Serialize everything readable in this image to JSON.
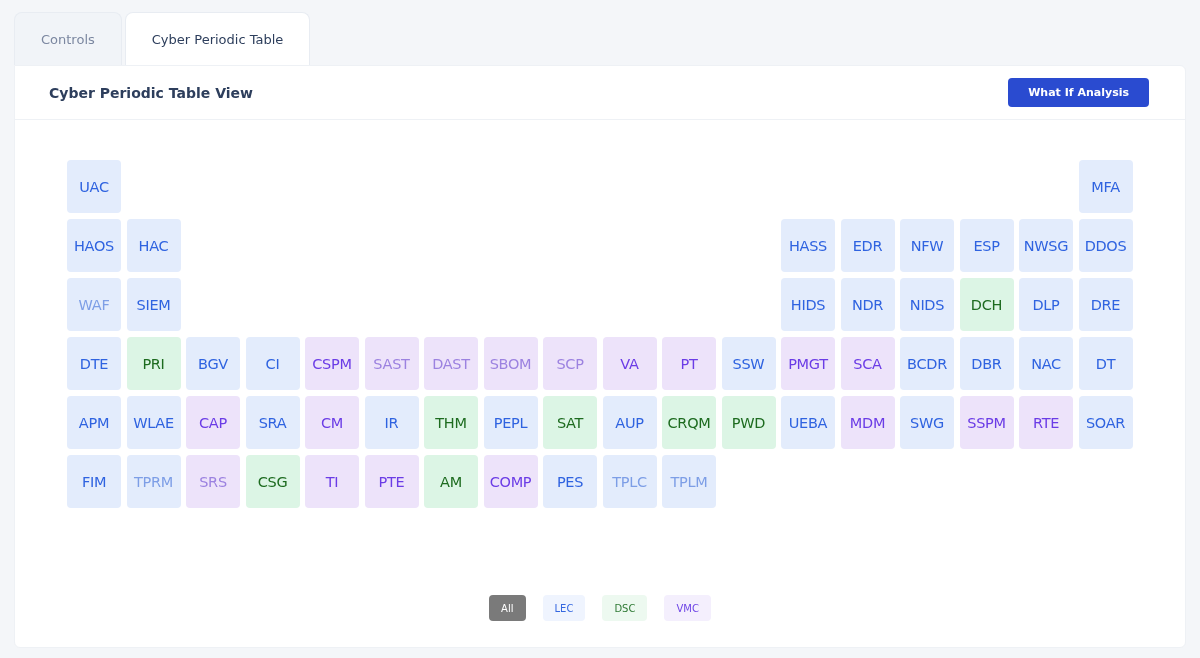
{
  "tabs": [
    {
      "label": "Controls",
      "selected": false
    },
    {
      "label": "Cyber Periodic Table",
      "selected": true
    }
  ],
  "panel": {
    "title": "Cyber Periodic Table View",
    "button": "What If Analysis"
  },
  "rows": [
    {
      "left": [
        {
          "code": "UAC",
          "kind": "lec",
          "dimmed": false
        }
      ],
      "right": [
        {
          "code": "MFA",
          "kind": "lec",
          "dimmed": false
        }
      ]
    },
    {
      "left": [
        {
          "code": "HAOS",
          "kind": "lec",
          "dimmed": false
        },
        {
          "code": "HAC",
          "kind": "lec",
          "dimmed": false
        }
      ],
      "right": [
        {
          "code": "HASS",
          "kind": "lec",
          "dimmed": false
        },
        {
          "code": "EDR",
          "kind": "lec",
          "dimmed": false
        },
        {
          "code": "NFW",
          "kind": "lec",
          "dimmed": false
        },
        {
          "code": "ESP",
          "kind": "lec",
          "dimmed": false
        },
        {
          "code": "NWSG",
          "kind": "lec",
          "dimmed": false
        },
        {
          "code": "DDOS",
          "kind": "lec",
          "dimmed": false
        }
      ]
    },
    {
      "left": [
        {
          "code": "WAF",
          "kind": "lec",
          "dimmed": true
        },
        {
          "code": "SIEM",
          "kind": "lec",
          "dimmed": false
        }
      ],
      "right": [
        {
          "code": "HIDS",
          "kind": "lec",
          "dimmed": false
        },
        {
          "code": "NDR",
          "kind": "lec",
          "dimmed": false
        },
        {
          "code": "NIDS",
          "kind": "lec",
          "dimmed": false
        },
        {
          "code": "DCH",
          "kind": "dsc",
          "dimmed": false
        },
        {
          "code": "DLP",
          "kind": "lec",
          "dimmed": false
        },
        {
          "code": "DRE",
          "kind": "lec",
          "dimmed": false
        }
      ]
    },
    {
      "left": [
        {
          "code": "DTE",
          "kind": "lec",
          "dimmed": false
        },
        {
          "code": "PRI",
          "kind": "dsc",
          "dimmed": false
        },
        {
          "code": "BGV",
          "kind": "lec",
          "dimmed": false
        },
        {
          "code": "CI",
          "kind": "lec",
          "dimmed": false
        },
        {
          "code": "CSPM",
          "kind": "vmc",
          "dimmed": false
        },
        {
          "code": "SAST",
          "kind": "vmc",
          "dimmed": true
        },
        {
          "code": "DAST",
          "kind": "vmc",
          "dimmed": true
        },
        {
          "code": "SBOM",
          "kind": "vmc",
          "dimmed": true
        },
        {
          "code": "SCP",
          "kind": "vmc",
          "dimmed": true
        },
        {
          "code": "VA",
          "kind": "vmc",
          "dimmed": false
        },
        {
          "code": "PT",
          "kind": "vmc",
          "dimmed": false
        },
        {
          "code": "SSW",
          "kind": "lec",
          "dimmed": false
        },
        {
          "code": "PMGT",
          "kind": "vmc",
          "dimmed": false
        },
        {
          "code": "SCA",
          "kind": "vmc",
          "dimmed": false
        },
        {
          "code": "BCDR",
          "kind": "lec",
          "dimmed": false
        },
        {
          "code": "DBR",
          "kind": "lec",
          "dimmed": false
        },
        {
          "code": "NAC",
          "kind": "lec",
          "dimmed": false
        },
        {
          "code": "DT",
          "kind": "lec",
          "dimmed": false
        }
      ],
      "right": []
    },
    {
      "left": [
        {
          "code": "APM",
          "kind": "lec",
          "dimmed": false
        },
        {
          "code": "WLAE",
          "kind": "lec",
          "dimmed": false
        },
        {
          "code": "CAP",
          "kind": "vmc",
          "dimmed": false
        },
        {
          "code": "SRA",
          "kind": "lec",
          "dimmed": false
        },
        {
          "code": "CM",
          "kind": "vmc",
          "dimmed": false
        },
        {
          "code": "IR",
          "kind": "lec",
          "dimmed": false
        },
        {
          "code": "THM",
          "kind": "dsc",
          "dimmed": false
        },
        {
          "code": "PEPL",
          "kind": "lec",
          "dimmed": false
        },
        {
          "code": "SAT",
          "kind": "dsc",
          "dimmed": false
        },
        {
          "code": "AUP",
          "kind": "lec",
          "dimmed": false
        },
        {
          "code": "CRQM",
          "kind": "dsc",
          "dimmed": false
        },
        {
          "code": "PWD",
          "kind": "dsc",
          "dimmed": false
        },
        {
          "code": "UEBA",
          "kind": "lec",
          "dimmed": false
        },
        {
          "code": "MDM",
          "kind": "vmc",
          "dimmed": false
        },
        {
          "code": "SWG",
          "kind": "lec",
          "dimmed": false
        },
        {
          "code": "SSPM",
          "kind": "vmc",
          "dimmed": false
        },
        {
          "code": "RTE",
          "kind": "vmc",
          "dimmed": false
        },
        {
          "code": "SOAR",
          "kind": "lec",
          "dimmed": false
        }
      ],
      "right": []
    },
    {
      "left": [
        {
          "code": "FIM",
          "kind": "lec",
          "dimmed": false
        },
        {
          "code": "TPRM",
          "kind": "lec",
          "dimmed": true
        },
        {
          "code": "SRS",
          "kind": "vmc",
          "dimmed": true
        },
        {
          "code": "CSG",
          "kind": "dsc",
          "dimmed": false
        },
        {
          "code": "TI",
          "kind": "vmc",
          "dimmed": false
        },
        {
          "code": "PTE",
          "kind": "vmc",
          "dimmed": false
        },
        {
          "code": "AM",
          "kind": "dsc",
          "dimmed": false
        },
        {
          "code": "COMP",
          "kind": "vmc",
          "dimmed": false
        },
        {
          "code": "PES",
          "kind": "lec",
          "dimmed": false
        },
        {
          "code": "TPLC",
          "kind": "lec",
          "dimmed": true
        },
        {
          "code": "TPLM",
          "kind": "lec",
          "dimmed": true
        }
      ],
      "right": []
    }
  ],
  "filters": [
    {
      "label": "All",
      "kind": "all",
      "selected": true
    },
    {
      "label": "LEC",
      "kind": "lec",
      "selected": false
    },
    {
      "label": "DSC",
      "kind": "dsc",
      "selected": false
    },
    {
      "label": "VMC",
      "kind": "vmc",
      "selected": false
    }
  ]
}
